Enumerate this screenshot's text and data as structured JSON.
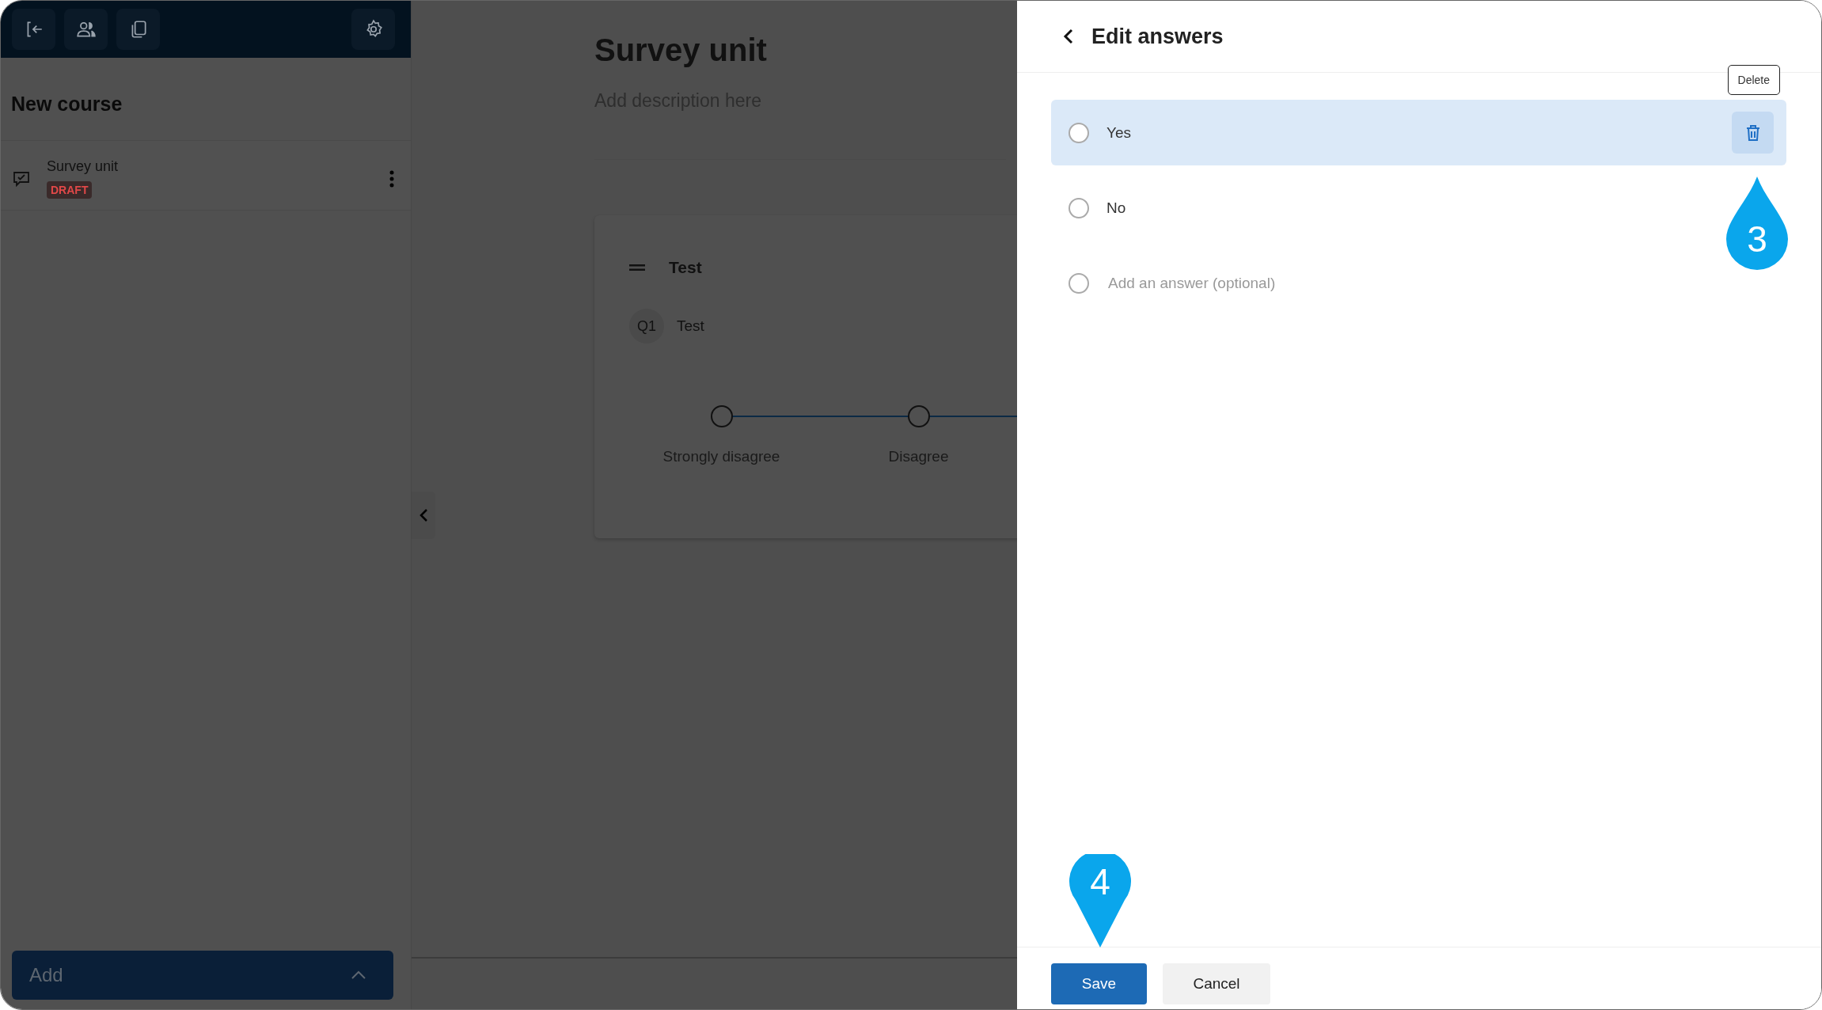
{
  "sidebar": {
    "title": "New course",
    "items": [
      {
        "title": "Survey unit",
        "badge": "DRAFT"
      }
    ],
    "add_button": "Add"
  },
  "main": {
    "title": "Survey unit",
    "description": {
      "placeholder": "Add description here"
    },
    "card": {
      "title": "Test",
      "question": {
        "number": "Q1",
        "text": "Test"
      },
      "scale": [
        {
          "label": "Strongly disagree",
          "selected": false
        },
        {
          "label": "Disagree",
          "selected": false
        }
      ]
    }
  },
  "panel": {
    "title": "Edit answers",
    "answers": [
      {
        "kind": "answer",
        "text": "Yes",
        "selected": true,
        "checked": false
      },
      {
        "kind": "answer",
        "text": "No",
        "selected": false,
        "checked": false
      },
      {
        "kind": "new",
        "placeholder": "Add an answer (optional)",
        "selected": false,
        "checked": false
      }
    ],
    "tooltip": "Delete",
    "buttons": [
      {
        "kind": "primary",
        "label": "Save"
      },
      {
        "kind": "secondary",
        "label": "Cancel"
      }
    ]
  },
  "markers": [
    {
      "label": "3",
      "kind": "up"
    },
    {
      "label": "4",
      "kind": "down"
    }
  ]
}
